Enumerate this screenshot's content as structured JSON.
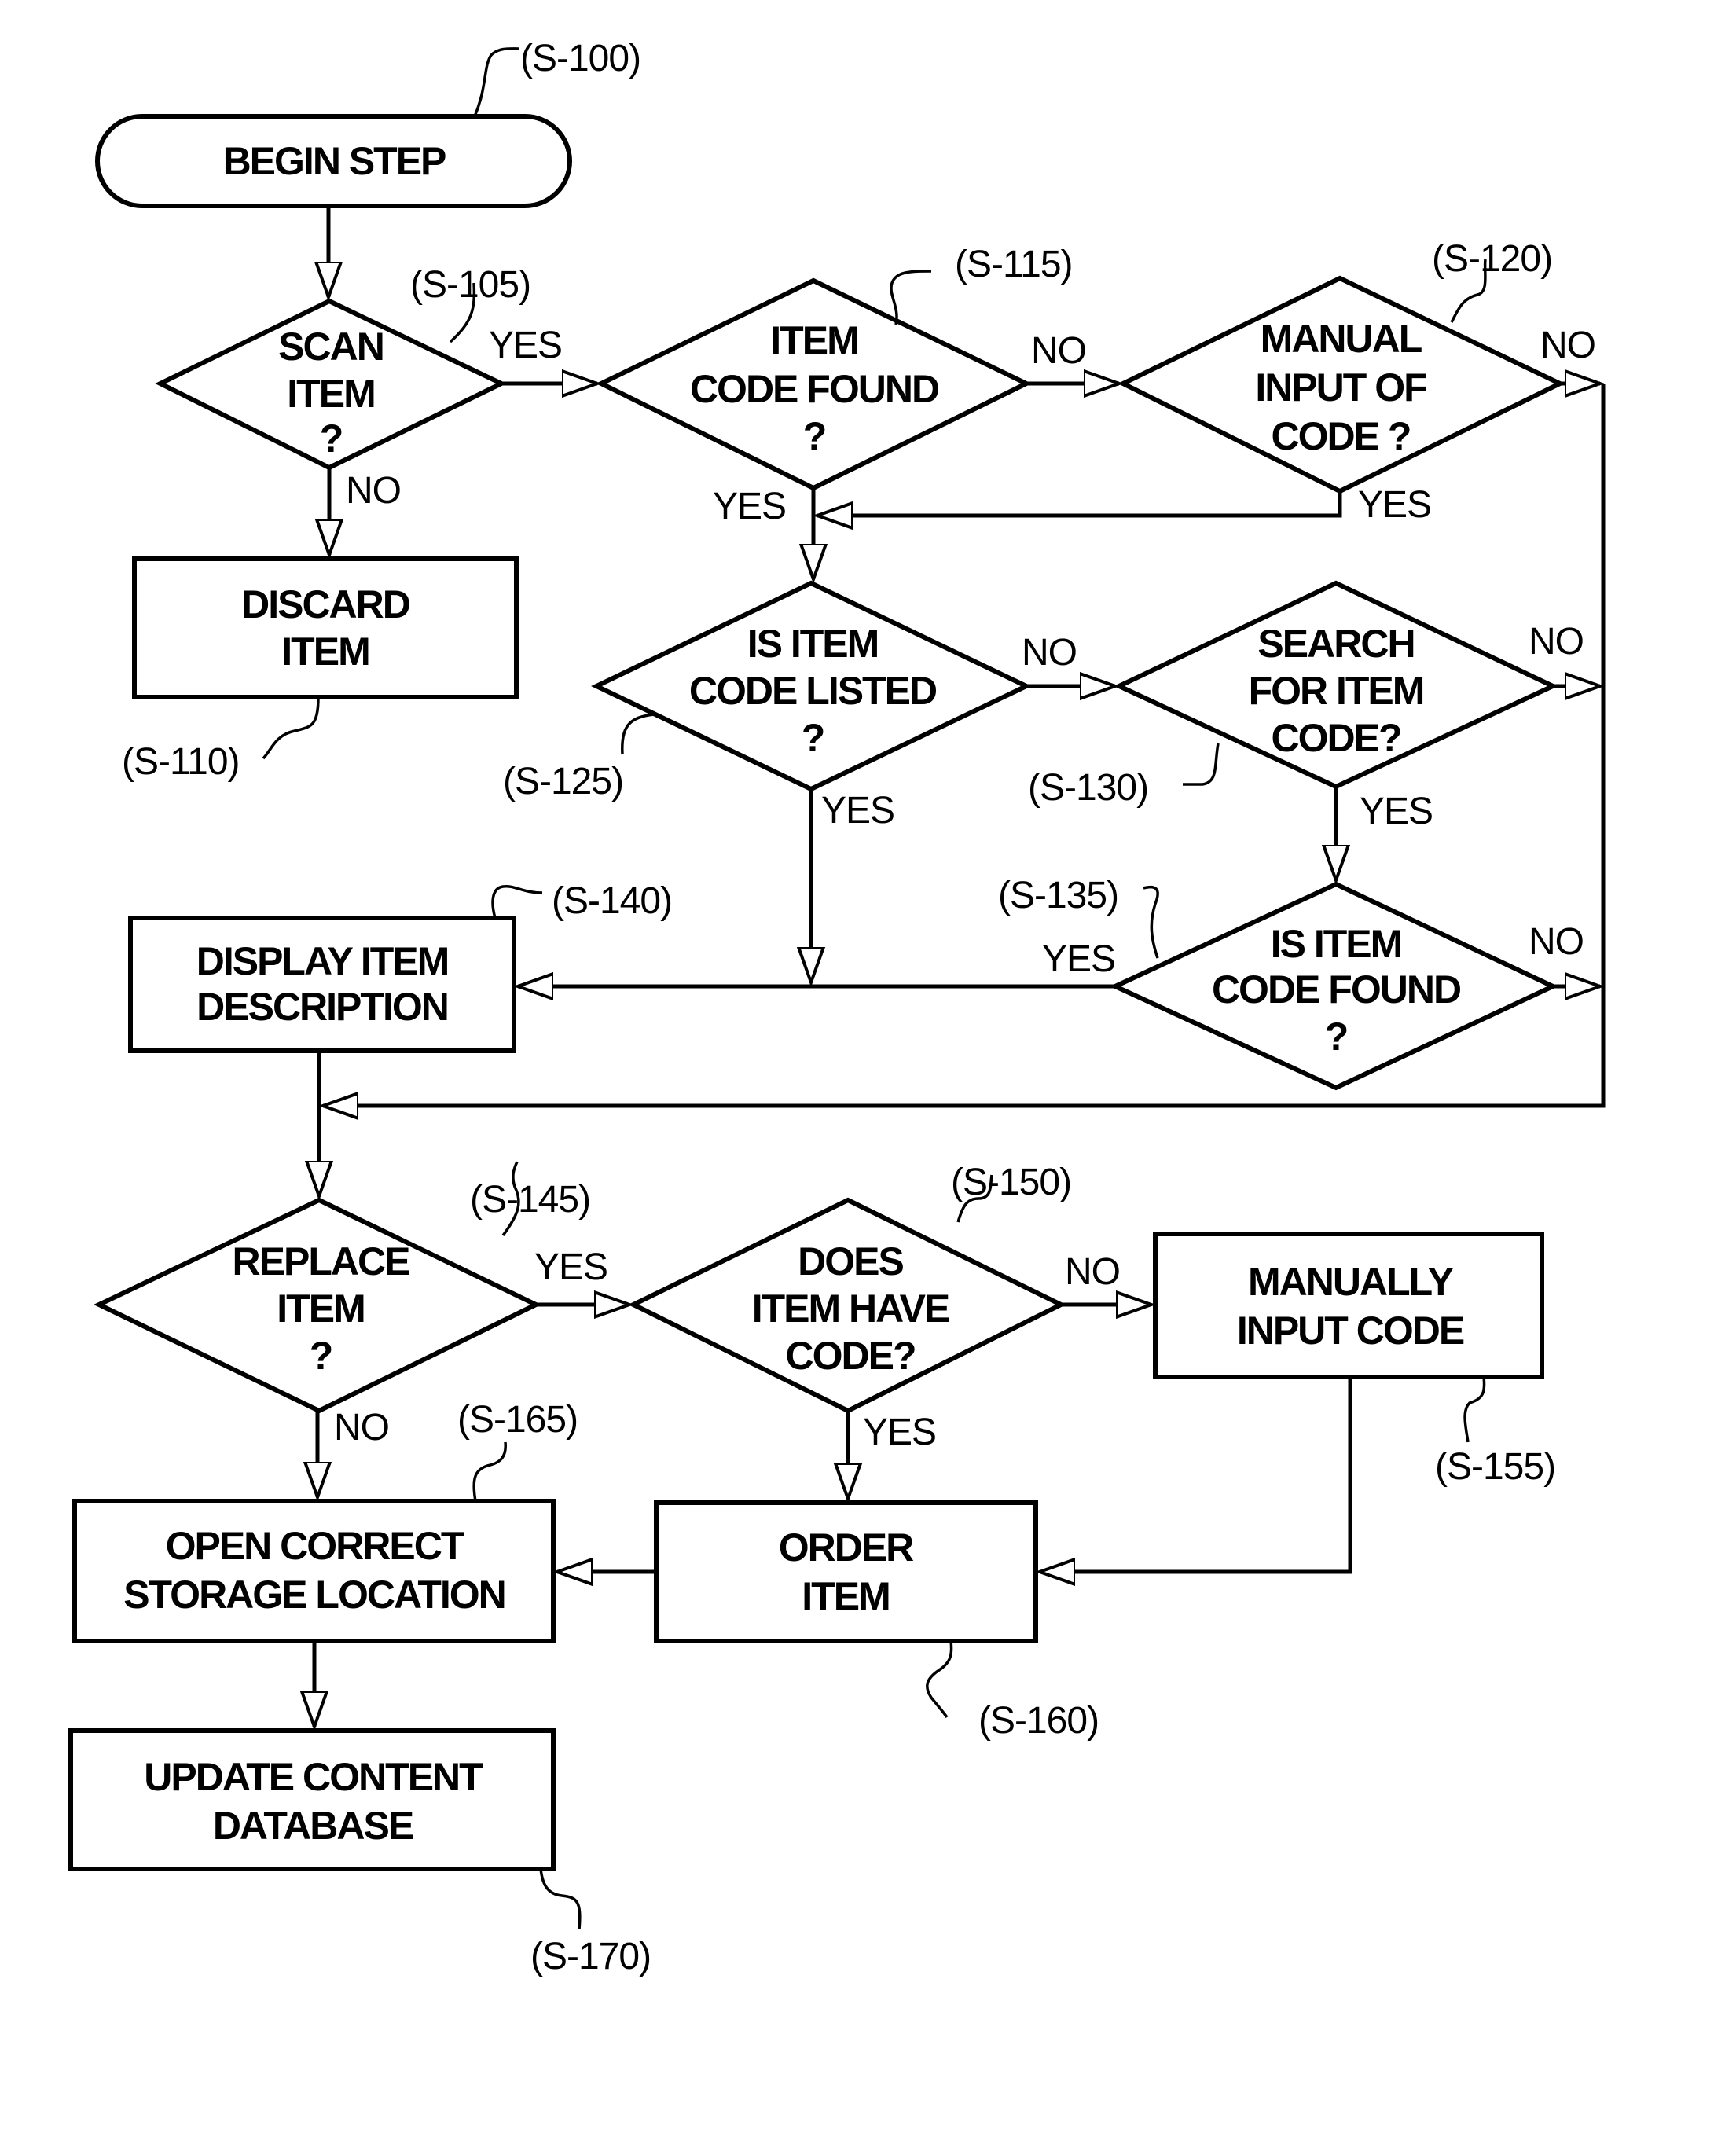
{
  "diagram": {
    "type": "flowchart",
    "nodes": [
      {
        "id": "S-100",
        "shape": "terminal",
        "lines": [
          "BEGIN STEP"
        ],
        "ref": "(S-100)"
      },
      {
        "id": "S-105",
        "shape": "decision",
        "lines": [
          "SCAN",
          "ITEM",
          "?"
        ],
        "ref": "(S-105)"
      },
      {
        "id": "S-110",
        "shape": "process",
        "lines": [
          "DISCARD",
          "ITEM"
        ],
        "ref": "(S-110)"
      },
      {
        "id": "S-115",
        "shape": "decision",
        "lines": [
          "ITEM",
          "CODE FOUND",
          "?"
        ],
        "ref": "(S-115)"
      },
      {
        "id": "S-120",
        "shape": "decision",
        "lines": [
          "MANUAL",
          "INPUT OF",
          "CODE ?"
        ],
        "ref": "(S-120)"
      },
      {
        "id": "S-125",
        "shape": "decision",
        "lines": [
          "IS ITEM",
          "CODE LISTED",
          "?"
        ],
        "ref": "(S-125)"
      },
      {
        "id": "S-130",
        "shape": "decision",
        "lines": [
          "SEARCH",
          "FOR ITEM",
          "CODE?"
        ],
        "ref": "(S-130)"
      },
      {
        "id": "S-135",
        "shape": "decision",
        "lines": [
          "IS ITEM",
          "CODE FOUND",
          "?"
        ],
        "ref": "(S-135)"
      },
      {
        "id": "S-140",
        "shape": "process",
        "lines": [
          "DISPLAY ITEM",
          "DESCRIPTION"
        ],
        "ref": "(S-140)"
      },
      {
        "id": "S-145",
        "shape": "decision",
        "lines": [
          "REPLACE",
          "ITEM",
          "?"
        ],
        "ref": "(S-145)"
      },
      {
        "id": "S-150",
        "shape": "decision",
        "lines": [
          "DOES",
          "ITEM HAVE",
          "CODE?"
        ],
        "ref": "(S-150)"
      },
      {
        "id": "S-155",
        "shape": "process",
        "lines": [
          "MANUALLY",
          "INPUT CODE"
        ],
        "ref": "(S-155)"
      },
      {
        "id": "S-160",
        "shape": "process",
        "lines": [
          "ORDER",
          "ITEM"
        ],
        "ref": "(S-160)"
      },
      {
        "id": "S-165",
        "shape": "process",
        "lines": [
          "OPEN CORRECT",
          "STORAGE LOCATION"
        ],
        "ref": "(S-165)"
      },
      {
        "id": "S-170",
        "shape": "process",
        "lines": [
          "UPDATE CONTENT",
          "DATABASE"
        ],
        "ref": "(S-170)"
      }
    ],
    "edges": [
      {
        "from": "S-100",
        "to": "S-105",
        "label": ""
      },
      {
        "from": "S-105",
        "to": "S-115",
        "label": "YES"
      },
      {
        "from": "S-105",
        "to": "S-110",
        "label": "NO"
      },
      {
        "from": "S-115",
        "to": "S-120",
        "label": "NO"
      },
      {
        "from": "S-115",
        "to": "S-125",
        "label": "YES"
      },
      {
        "from": "S-120",
        "to": "S-125",
        "label": "YES"
      },
      {
        "from": "S-120",
        "to": "S-145",
        "label": "NO"
      },
      {
        "from": "S-125",
        "to": "S-130",
        "label": "NO"
      },
      {
        "from": "S-125",
        "to": "S-140",
        "label": "YES"
      },
      {
        "from": "S-130",
        "to": "S-135",
        "label": "YES"
      },
      {
        "from": "S-130",
        "to": "S-145",
        "label": "NO"
      },
      {
        "from": "S-135",
        "to": "S-140",
        "label": "YES"
      },
      {
        "from": "S-135",
        "to": "S-145",
        "label": "NO"
      },
      {
        "from": "S-140",
        "to": "S-145",
        "label": ""
      },
      {
        "from": "S-145",
        "to": "S-150",
        "label": "YES"
      },
      {
        "from": "S-145",
        "to": "S-165",
        "label": "NO"
      },
      {
        "from": "S-150",
        "to": "S-155",
        "label": "NO"
      },
      {
        "from": "S-150",
        "to": "S-160",
        "label": "YES"
      },
      {
        "from": "S-155",
        "to": "S-160",
        "label": ""
      },
      {
        "from": "S-160",
        "to": "S-165",
        "label": ""
      },
      {
        "from": "S-165",
        "to": "S-170",
        "label": ""
      }
    ],
    "branch_labels": {
      "yes": "YES",
      "no": "NO"
    }
  }
}
